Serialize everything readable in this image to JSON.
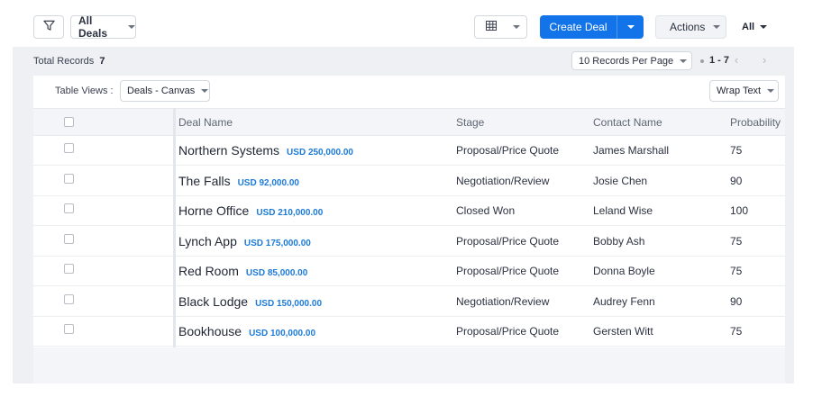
{
  "toolbar": {
    "view_select": "All Deals",
    "create_label": "Create Deal",
    "actions_label": "Actions",
    "all_label": "All"
  },
  "summary": {
    "total_label": "Total Records",
    "total_count": "7",
    "per_page": "10 Records Per Page",
    "range": "1 - 7"
  },
  "table_views": {
    "label": "Table Views :",
    "selected": "Deals - Canvas",
    "wrap_label": "Wrap Text"
  },
  "columns": [
    "Deal Name",
    "Stage",
    "Contact Name",
    "Probability"
  ],
  "rows": [
    {
      "name": "Northern Systems",
      "amount": "USD 250,000.00",
      "stage": "Proposal/Price Quote",
      "contact": "James Marshall",
      "probability": "75"
    },
    {
      "name": "The Falls",
      "amount": "USD 92,000.00",
      "stage": "Negotiation/Review",
      "contact": "Josie Chen",
      "probability": "90"
    },
    {
      "name": "Horne Office",
      "amount": "USD 210,000.00",
      "stage": "Closed Won",
      "contact": "Leland Wise",
      "probability": "100"
    },
    {
      "name": "Lynch App",
      "amount": "USD 175,000.00",
      "stage": "Proposal/Price Quote",
      "contact": "Bobby Ash",
      "probability": "75"
    },
    {
      "name": "Red Room",
      "amount": "USD 85,000.00",
      "stage": "Proposal/Price Quote",
      "contact": "Donna Boyle",
      "probability": "75"
    },
    {
      "name": "Black Lodge",
      "amount": "USD 150,000.00",
      "stage": "Negotiation/Review",
      "contact": "Audrey Fenn",
      "probability": "90"
    },
    {
      "name": "Bookhouse",
      "amount": "USD 100,000.00",
      "stage": "Proposal/Price Quote",
      "contact": "Gersten Witt",
      "probability": "75"
    }
  ],
  "colors": {
    "primary": "#1274e8",
    "amount": "#1c7ad9",
    "panel": "#eef0f4"
  }
}
